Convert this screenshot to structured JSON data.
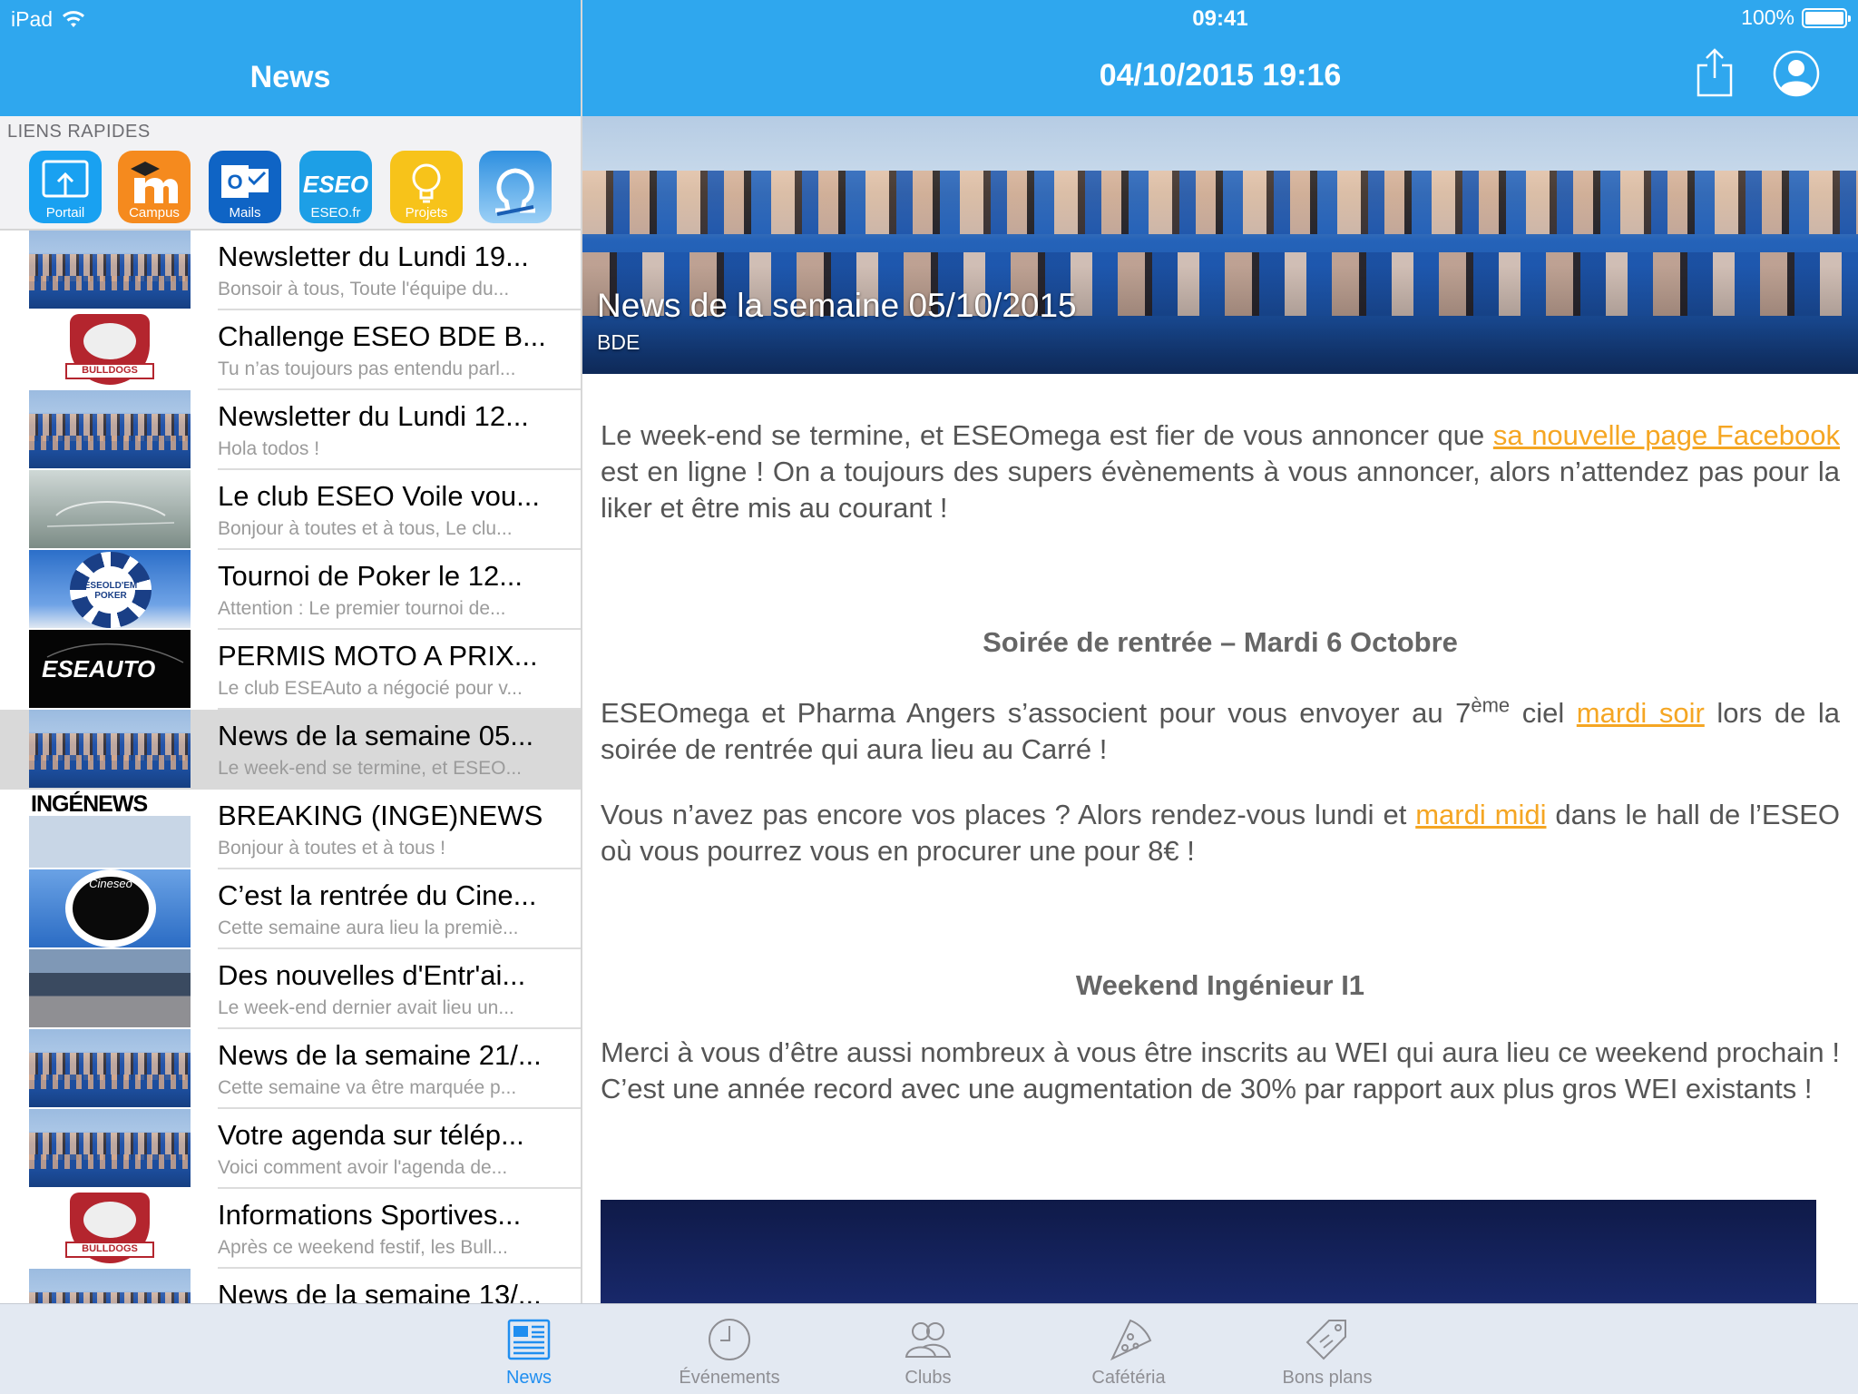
{
  "status_bar": {
    "device": "iPad",
    "time": "09:41",
    "battery": "100%"
  },
  "left_panel": {
    "title": "News",
    "quick_links_label": "LIENS RAPIDES",
    "quick_links": [
      {
        "label": "Portail",
        "color": "#1aa0f0"
      },
      {
        "label": "Campus",
        "color": "#f58a1e"
      },
      {
        "label": "Mails",
        "color": "#0f64c5"
      },
      {
        "label": "ESEO.fr",
        "color": "#1d9fe6",
        "logo_text": "ESEO"
      },
      {
        "label": "Projets",
        "color": "#f7c31a"
      },
      {
        "label": "",
        "color": "#2d8fe0"
      }
    ],
    "news": [
      {
        "title": "Newsletter du Lundi 19...",
        "subtitle": "Bonsoir à tous, Toute l'équipe du...",
        "thumb": "group-photo"
      },
      {
        "title": "Challenge ESEO BDE B...",
        "subtitle": "Tu n’as toujours pas entendu parl...",
        "thumb": "bulldogs-logo",
        "badge_text": "BULLDOGS"
      },
      {
        "title": "Newsletter du Lundi 12...",
        "subtitle": "Hola todos !",
        "thumb": "group-photo"
      },
      {
        "title": "Le club ESEO Voile vou...",
        "subtitle": "Bonjour à toutes et à tous, Le clu...",
        "thumb": "sail-logo"
      },
      {
        "title": "Tournoi de Poker le 12...",
        "subtitle": "Attention : Le premier tournoi de...",
        "thumb": "poker-chip",
        "badge_text": "ESEOLD'EM POKER"
      },
      {
        "title": "PERMIS MOTO A PRIX...",
        "subtitle": "Le club ESEAuto a négocié pour v...",
        "thumb": "eseauto-logo",
        "badge_text": "ESEAUTO"
      },
      {
        "title": "News de la semaine 05...",
        "subtitle": "Le week-end se termine, et ESEO...",
        "thumb": "group-photo",
        "selected": true
      },
      {
        "title": "BREAKING (INGE)NEWS",
        "subtitle": "Bonjour à toutes et à tous !",
        "thumb": "ingenews-logo",
        "badge_text": "INGÉNEWS"
      },
      {
        "title": "C’est la rentrée du Cine...",
        "subtitle": "Cette semaine aura lieu la premiè...",
        "thumb": "cineseo-logo",
        "badge_text": "Cineseo"
      },
      {
        "title": "Des nouvelles d'Entr'ai...",
        "subtitle": "Le week-end dernier avait lieu un...",
        "thumb": "team-photo"
      },
      {
        "title": "News de la semaine 21/...",
        "subtitle": "Cette semaine va être marquée p...",
        "thumb": "group-photo"
      },
      {
        "title": "Votre agenda sur télép...",
        "subtitle": "Voici comment avoir l'agenda de...",
        "thumb": "group-photo"
      },
      {
        "title": "Informations Sportives...",
        "subtitle": "Après ce weekend festif, les Bull...",
        "thumb": "bulldogs-logo",
        "badge_text": "BULLDOGS"
      },
      {
        "title": "News de la semaine 13/...",
        "subtitle": "",
        "thumb": "group-photo"
      }
    ]
  },
  "detail": {
    "header_title": "04/10/2015 19:16",
    "hero_title": "News de la semaine 05/10/2015",
    "hero_subtitle": "BDE",
    "p1_before": "Le week-end se termine, et ESEOmega est fier de vous annoncer que ",
    "p1_link": "sa nouvelle page Facebook",
    "p1_after": " est en ligne ! On a toujours des supers évènements à vous annoncer, alors n’attendez pas pour la liker et être mis au courant !",
    "h1": "Soirée de rentrée – Mardi 6 Octobre",
    "p2_before": "ESEOmega et Pharma Angers s’associent pour vous envoyer au 7",
    "p2_sup": "ème",
    "p2_mid": " ciel ",
    "p2_link": "mardi soir",
    "p2_after": " lors de la soirée de rentrée qui aura lieu au Carré !",
    "p3_before": "Vous n’avez pas encore vos places ? Alors rendez-vous lundi et ",
    "p3_link": "mardi midi",
    "p3_after": " dans le hall de l’ESEO où vous pourrez vous en procurer une pour 8€ !",
    "h2": "Weekend Ingénieur I1",
    "p4": "Merci à vous d’être aussi nombreux à vous être inscrits au WEI qui aura lieu ce weekend prochain ! C’est une année record avec une augmentation de 30% par rapport aux plus gros WEI existants !"
  },
  "tabs": [
    {
      "label": "News",
      "icon": "newspaper-icon",
      "active": true
    },
    {
      "label": "Événements",
      "icon": "clock-icon",
      "active": false
    },
    {
      "label": "Clubs",
      "icon": "people-icon",
      "active": false
    },
    {
      "label": "Cafétéria",
      "icon": "pizza-icon",
      "active": false
    },
    {
      "label": "Bons plans",
      "icon": "tag-icon",
      "active": false
    }
  ],
  "colors": {
    "nav_blue": "#2fa7ee",
    "link_orange": "#f5a623",
    "tab_active": "#1f8ef0"
  }
}
